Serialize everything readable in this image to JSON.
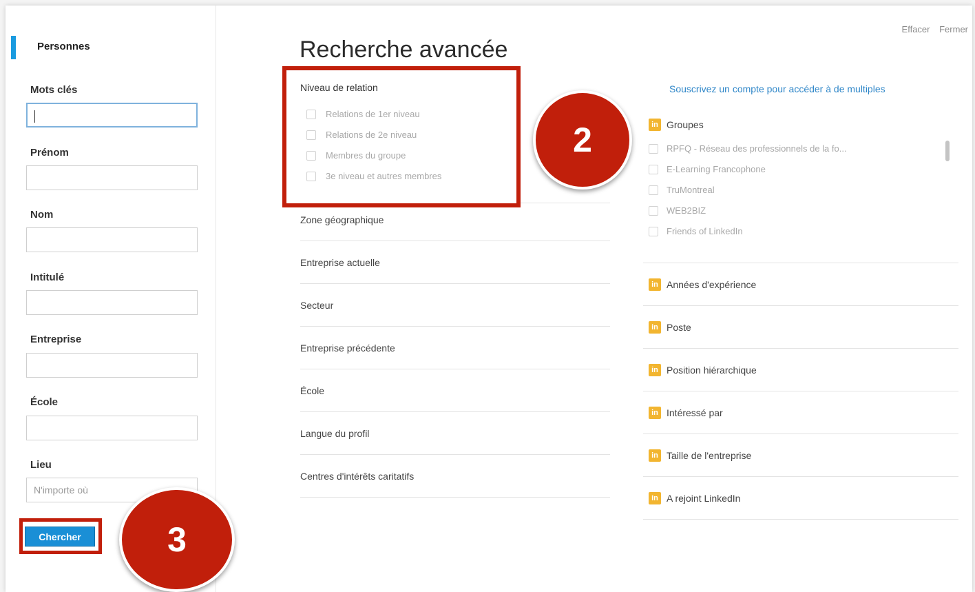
{
  "header": {
    "clear_link": "Effacer",
    "close_link": "Fermer"
  },
  "sidebar": {
    "tab_label": "Personnes",
    "fields": [
      {
        "label": "Mots clés",
        "value": "",
        "placeholder": ""
      },
      {
        "label": "Prénom",
        "value": "",
        "placeholder": ""
      },
      {
        "label": "Nom",
        "value": "",
        "placeholder": ""
      },
      {
        "label": "Intitulé",
        "value": "",
        "placeholder": ""
      },
      {
        "label": "Entreprise",
        "value": "",
        "placeholder": ""
      },
      {
        "label": "École",
        "value": "",
        "placeholder": ""
      },
      {
        "label": "Lieu",
        "value": "",
        "placeholder": "N'importe où"
      }
    ],
    "search_button": "Chercher"
  },
  "main": {
    "title": "Recherche avancée",
    "relation": {
      "title": "Niveau de relation",
      "options": [
        {
          "label": "Relations de 1er niveau",
          "checked": false
        },
        {
          "label": "Relations de 2e niveau",
          "checked": false
        },
        {
          "label": "Membres du groupe",
          "checked": false
        },
        {
          "label": "3e niveau et autres membres",
          "checked": false
        }
      ]
    },
    "facets": [
      "Zone géographique",
      "Entreprise actuelle",
      "Secteur",
      "Entreprise précédente",
      "École",
      "Langue du profil",
      "Centres d'intérêts caritatifs"
    ]
  },
  "premium": {
    "upsell_text": "Souscrivez un compte pour accéder à de multiples",
    "icon_text": "in",
    "groups_label": "Groupes",
    "groups": [
      "RPFQ - Réseau des professionnels de la fo...",
      "E-Learning Francophone",
      "TruMontreal",
      "WEB2BIZ",
      "Friends of LinkedIn"
    ],
    "facets": [
      "Années d'expérience",
      "Poste",
      "Position hiérarchique",
      "Intéressé par",
      "Taille de l'entreprise",
      "A rejoint LinkedIn"
    ]
  },
  "callouts": {
    "relation_step": "2",
    "search_step": "3"
  },
  "colors": {
    "accent_blue": "#1a8fd6",
    "callout_red": "#c11f0b",
    "linkedin_premium": "#f2b530"
  }
}
